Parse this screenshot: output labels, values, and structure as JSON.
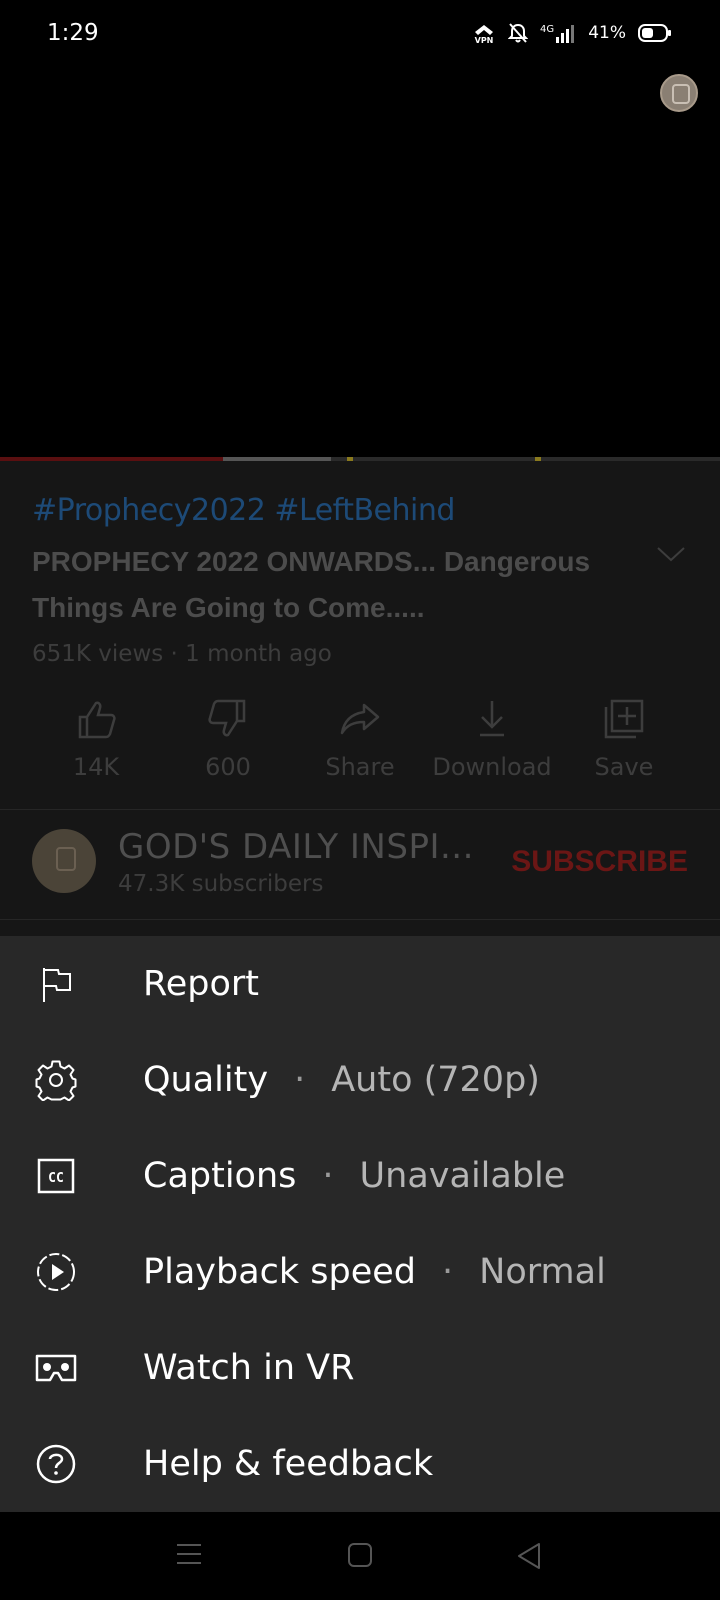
{
  "status_bar": {
    "time": "1:29",
    "network": "4G",
    "battery": "41%",
    "icons": [
      "vpn-icon",
      "bell-off-icon",
      "signal-icon",
      "battery-icon"
    ]
  },
  "video": {
    "hashtags": "#Prophecy2022 #LeftBehind",
    "title": "PROPHECY 2022 ONWARDS... Dangerous Things Are Going to Come.....",
    "meta": "651K views · 1 month ago",
    "progress_played": 0.31,
    "progress_buffered": 0.46
  },
  "actions": [
    {
      "icon": "thumbs-up-icon",
      "label": "14K"
    },
    {
      "icon": "thumbs-down-icon",
      "label": "600"
    },
    {
      "icon": "share-icon",
      "label": "Share"
    },
    {
      "icon": "download-icon",
      "label": "Download"
    },
    {
      "icon": "save-icon",
      "label": "Save"
    }
  ],
  "channel": {
    "name": "GOD'S DAILY INSPI...",
    "subscribers": "47.3K subscribers",
    "subscribe_label": "SUBSCRIBE"
  },
  "menu": [
    {
      "icon": "flag-icon",
      "label": "Report",
      "value": ""
    },
    {
      "icon": "gear-icon",
      "label": "Quality",
      "value": "Auto (720p)"
    },
    {
      "icon": "captions-icon",
      "label": "Captions",
      "value": "Unavailable"
    },
    {
      "icon": "playback-speed-icon",
      "label": "Playback speed",
      "value": "Normal"
    },
    {
      "icon": "vr-icon",
      "label": "Watch in VR",
      "value": ""
    },
    {
      "icon": "help-icon",
      "label": "Help & feedback",
      "value": ""
    }
  ],
  "colors": {
    "hashtag": "#1d4a77",
    "subscribe": "#6b1615",
    "sheet_bg": "#282828"
  }
}
